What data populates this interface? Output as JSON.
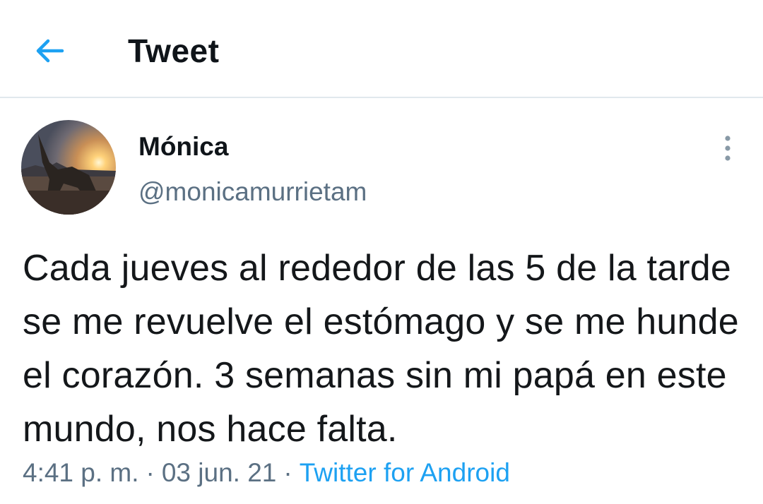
{
  "header": {
    "title": "Tweet"
  },
  "tweet": {
    "author": {
      "display_name": "Mónica",
      "handle": "@monicamurrietam"
    },
    "text": "Cada jueves al rededor de las 5 de la tarde se me revuelve el estómago y se me hunde el corazón. 3 semanas sin mi papá en este mundo, nos hace falta.",
    "time": "4:41 p. m.",
    "date": "03 jun. 21",
    "source": "Twitter for Android",
    "separator": "·"
  },
  "icons": {
    "back": "arrow-left-icon",
    "more": "more-vertical-icon"
  },
  "colors": {
    "accent": "#1da1f2",
    "secondary_text": "#5b7083",
    "primary_text": "#0f1419",
    "divider": "#e1e8ed"
  }
}
